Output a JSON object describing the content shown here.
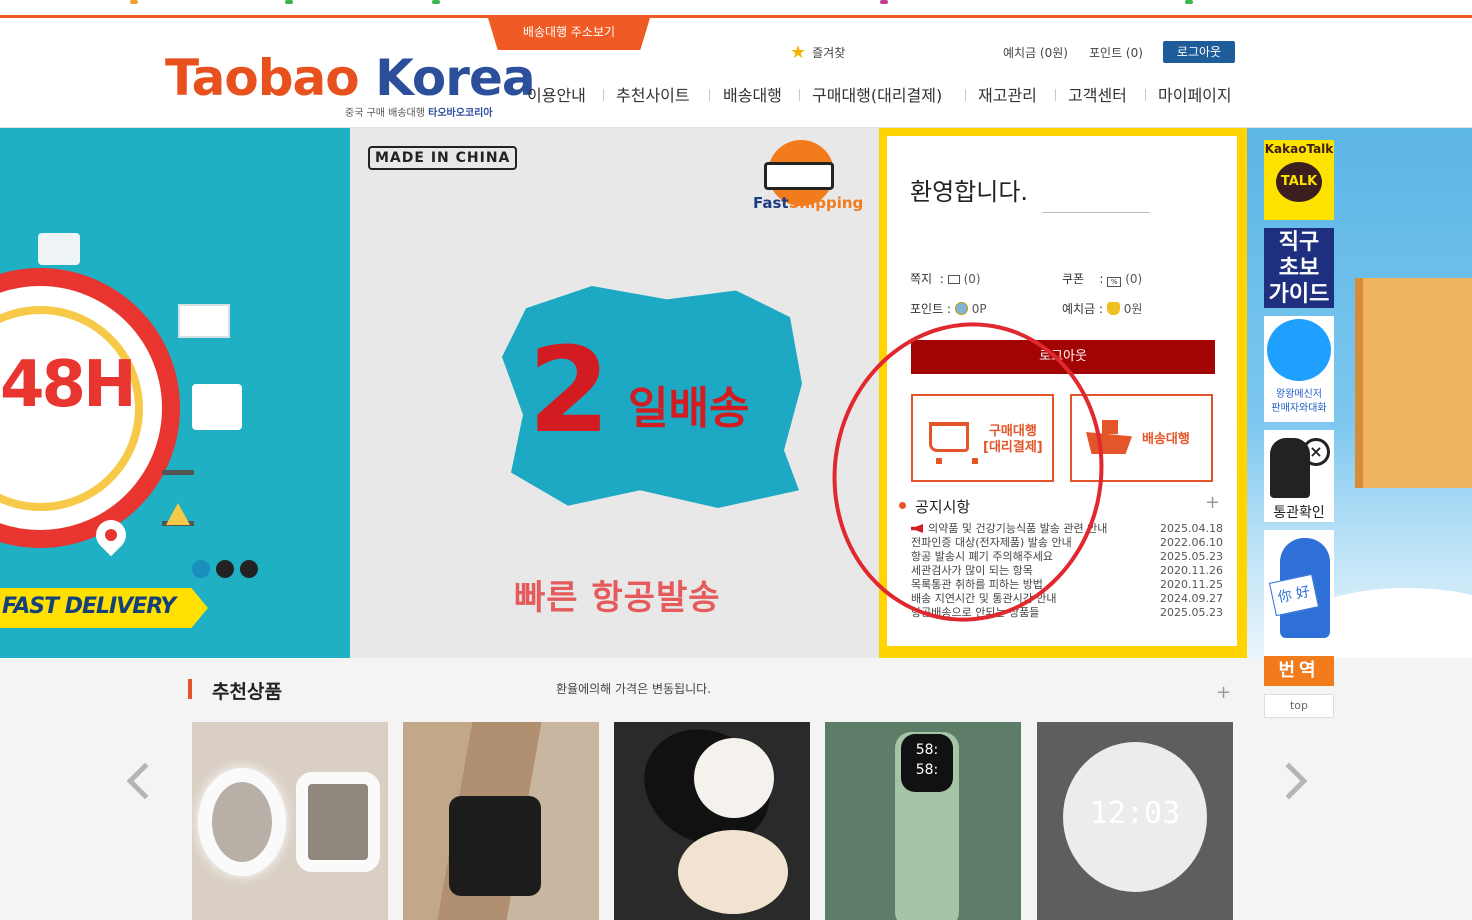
{
  "header": {
    "address_tab": "배송대행 주소보기",
    "logo_text_1": "T",
    "logo_text_2": "aobao ",
    "logo_text_3": "Korea",
    "logo_sub": "중국 구매 배송대행 ",
    "logo_sub_brand": "타오바오코리아",
    "util": {
      "favorites": "즐겨찾",
      "deposit": "예치금 (0원)",
      "points": "포인트 (0)",
      "logout": "로그아웃"
    },
    "nav": [
      "이용안내",
      "추천사이트",
      "배송대행",
      "구매대행(대리결제)",
      "재고관리",
      "고객센터",
      "마이페이지"
    ]
  },
  "banner_left": {
    "headline": "48H",
    "tag": "FAST DELIVERY"
  },
  "banner_center": {
    "made_in": "MADE IN CHINA",
    "fast_shipping_1": "Fast",
    "fast_shipping_2": "Shipping",
    "number": "2",
    "days": "일배송",
    "caption": "빠른 항공발송"
  },
  "welcome": {
    "title": "환영합니다.",
    "memo_label": "쪽지",
    "memo_value": "(0)",
    "coupon_label": "쿠폰",
    "coupon_value": "(0)",
    "point_label": "포인트",
    "point_value": "0P",
    "deposit_label": "예치금",
    "deposit_value": "0원",
    "logout": "로그아웃",
    "service_buy_1": "구매대행",
    "service_buy_2": "[대리결제]",
    "service_ship": "배송대행"
  },
  "notice": {
    "title": "공지시항",
    "plus": "+",
    "items": [
      {
        "title": "의약품 및 건강기능식품 발송 관련 안내",
        "date": "2025.04.18"
      },
      {
        "title": "전파인증 대상(전자제품) 발송 안내",
        "date": "2022.06.10"
      },
      {
        "title": "항공 발송시 폐기 주의해주세요",
        "date": "2025.05.23"
      },
      {
        "title": "세관검사가 많이 되는 항목",
        "date": "2020.11.26"
      },
      {
        "title": "목록통관 취하를 피하는 방법",
        "date": "2020.11.25"
      },
      {
        "title": "배송 지연시간 및 통관시간 안내",
        "date": "2024.09.27"
      },
      {
        "title": "항공배송으로 안되는 상품들",
        "date": "2025.05.23"
      }
    ]
  },
  "quick": {
    "kakao_label": "KakaoTalk",
    "kakao_bubble": "TALK",
    "guide": "직구\n초보\n가이드",
    "wangwang": "왕왕메신저\n판매자와대화",
    "customs": "통관확인",
    "translate_card": "你 好",
    "translate": "번역",
    "top": "top"
  },
  "recommended": {
    "title": "추천상품",
    "note": "환율에의해 가격은 변동됩니다.",
    "plus": "+",
    "clock_time": "12:03",
    "bottle_time_1": "58:",
    "bottle_time_2": "58:"
  },
  "colors": {
    "brand_orange": "#f05a24",
    "brand_blue": "#2c4f9c",
    "panel_yellow": "#ffd400",
    "logout_red": "#a20404",
    "annotation_red": "#e0282e"
  }
}
